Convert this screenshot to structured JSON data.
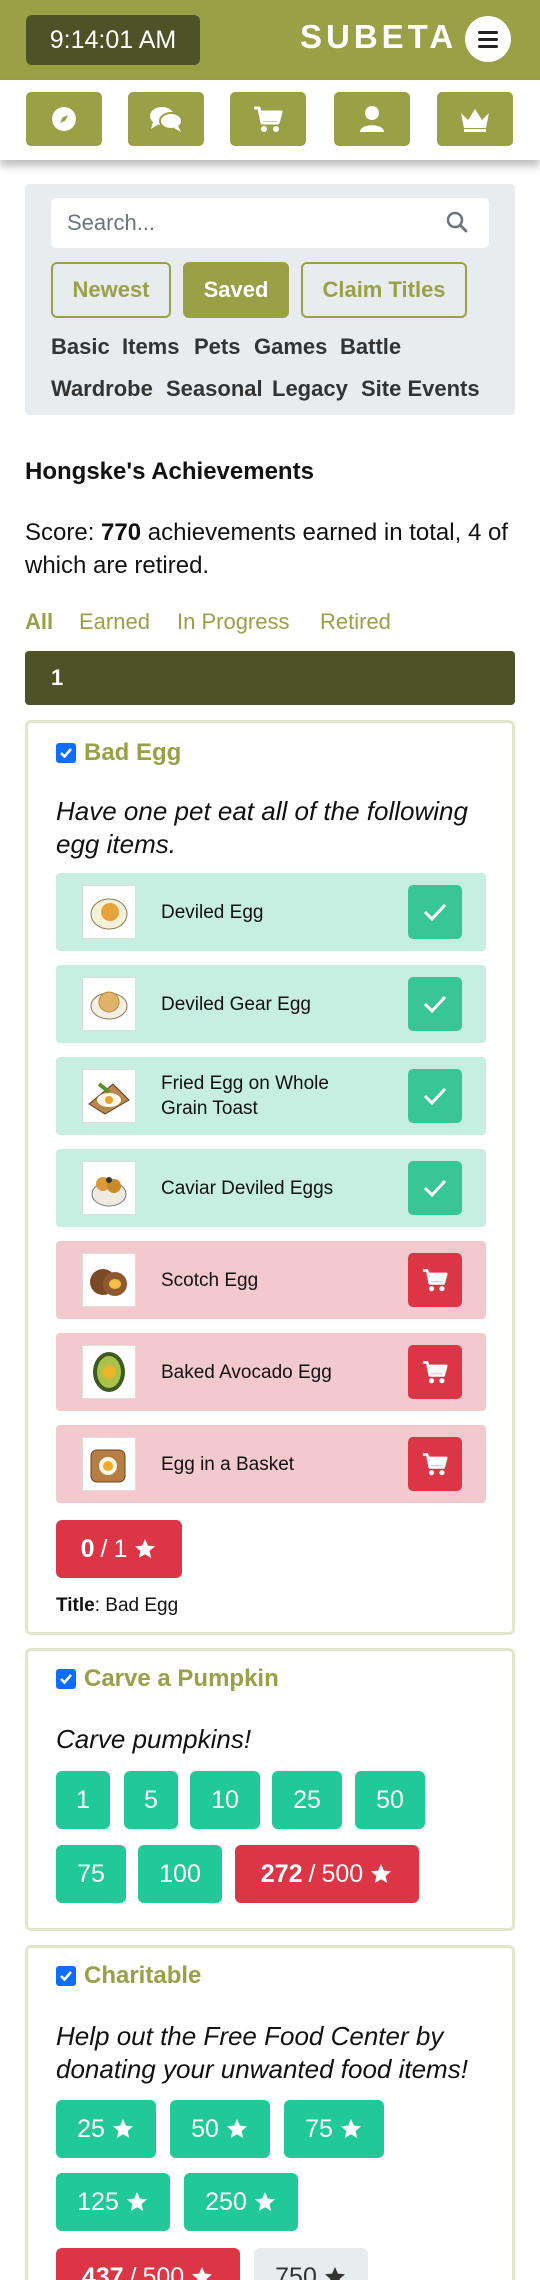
{
  "header": {
    "clock": "9:14:01 AM",
    "brand": "SUBETA",
    "menu_icon": "hamburger-icon"
  },
  "nav": [
    {
      "icon": "compass-icon"
    },
    {
      "icon": "chat-icon"
    },
    {
      "icon": "cart-icon"
    },
    {
      "icon": "user-icon"
    },
    {
      "icon": "crown-icon"
    }
  ],
  "search": {
    "placeholder": "Search...",
    "icon": "search-icon"
  },
  "pills": [
    "Newest",
    "Saved",
    "Claim Titles"
  ],
  "categories": [
    "Basic",
    "Items",
    "Pets",
    "Games",
    "Battle",
    "Wardrobe",
    "Seasonal",
    "Legacy",
    "Site Events"
  ],
  "page": {
    "heading": "Hongske's Achievements",
    "score_prefix": "Score: ",
    "score_value": "770",
    "score_suffix": " achievements earned in total, 4 of which are retired."
  },
  "filters": [
    "All",
    "Earned",
    "In Progress",
    "Retired"
  ],
  "pagination": {
    "current": "1"
  },
  "achievements": [
    {
      "name": "Bad Egg",
      "description": "Have one pet eat all of the following egg items.",
      "items": [
        {
          "name": "Deviled Egg",
          "status": "done"
        },
        {
          "name": "Deviled Gear Egg",
          "status": "done"
        },
        {
          "name": "Fried Egg on Whole Grain Toast",
          "status": "done"
        },
        {
          "name": "Caviar Deviled Eggs",
          "status": "done"
        },
        {
          "name": "Scotch Egg",
          "status": "need"
        },
        {
          "name": "Baked Avocado Egg",
          "status": "need"
        },
        {
          "name": "Egg in a Basket",
          "status": "need"
        }
      ],
      "progress": {
        "current": "0",
        "total": "1"
      },
      "title_label": "Title",
      "title_value": "Bad Egg"
    },
    {
      "name": "Carve a Pumpkin",
      "description": "Carve pumpkins!",
      "tiers": [
        "1",
        "5",
        "10",
        "25",
        "50",
        "75",
        "100"
      ],
      "progress": {
        "current": "272",
        "total": "500"
      }
    },
    {
      "name": "Charitable",
      "description": "Help out the Free Food Center by donating your unwanted food items!",
      "tiers": [
        "25",
        "50",
        "75",
        "125",
        "250"
      ],
      "progress": {
        "current": "437",
        "total": "500"
      },
      "next_tier": "750"
    }
  ],
  "colors": {
    "olive": "#9aa046",
    "olive_dark": "#4d5326",
    "green": "#20c997",
    "red": "#dc3545",
    "done_bg": "#c6efe1",
    "need_bg": "#f4c9ce"
  }
}
